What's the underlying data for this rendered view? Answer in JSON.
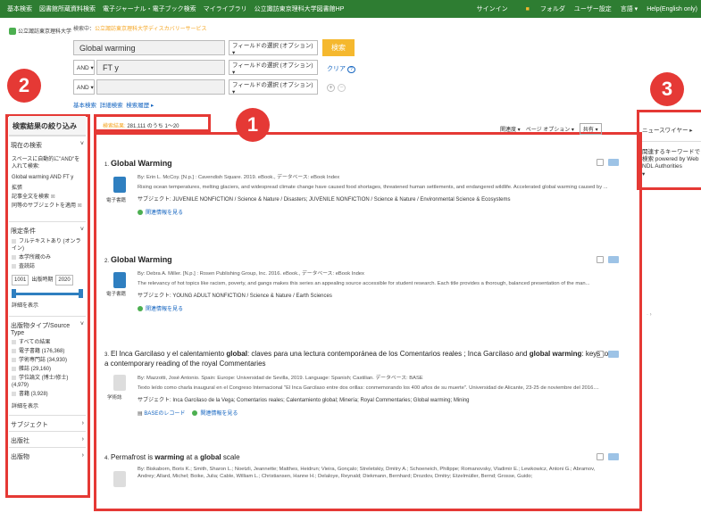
{
  "topnav": {
    "left": [
      "基本検索",
      "図書館所蔵資料検索",
      "電子ジャーナル・電子ブック検索",
      "マイライブラリ",
      "公立諏訪東京理科大学図書館HP"
    ],
    "right": [
      "サインイン",
      "フォルダ",
      "ユーザー設定",
      "言語 ▾",
      "Help(English only)"
    ]
  },
  "logo_text": "公立諏訪東京理科大学",
  "search": {
    "header_prefix": "検索中：",
    "header_highlight": "公立諏訪東京理科大学ディスカバリーサービス",
    "row1_value": "Global warming",
    "row2_op": "AND ▾",
    "row2_value": "FT y",
    "row3_op": "AND ▾",
    "row3_value": "",
    "field_select": "フィールドの選択 (オプション) ▾",
    "search_button": "検索",
    "clear": "クリア",
    "help": "?",
    "links": [
      "基本検索",
      "詳細検索",
      "検索履歴 ▸"
    ]
  },
  "annotations": [
    "2",
    "1",
    "3"
  ],
  "sidebar": {
    "title": "検索結果の絞り込み",
    "current_search": "現在の検索",
    "hint": "スペースに自動的に\"AND\"を入れて検索:",
    "query": "Global warming AND FT y",
    "expanders": "拡張",
    "expand1": "記事全文を検索",
    "expand2": "同等のサブジェクトを適用",
    "limiters": "限定条件",
    "lim1": "フルテキストあり (オンライン)",
    "lim2": "本学所蔵のみ",
    "lim3": "査読誌",
    "year_from": "1001",
    "year_label": "出版時期",
    "year_to": "2020",
    "show_more1": "詳細を表示",
    "source_type": "出版物タイプ/Source Type",
    "types": [
      "すべての結果",
      "電子書籍 (176,368)",
      "学術専門誌 (34,930)",
      "雑誌 (29,160)",
      "学位論文 (博士/修士) (4,979)",
      "書籍 (3,928)"
    ],
    "show_more2": "詳細を表示",
    "facets": [
      "サブジェクト",
      "出版社",
      "出版物"
    ]
  },
  "results_header": {
    "count_prefix": "検索結果:",
    "count": "281,111 のうち 1〜20",
    "sort": "関連度 ▾",
    "page_options": "ページ オプション ▾",
    "share": "共有 ▾"
  },
  "results": [
    {
      "num": "1.",
      "title": "Global Warming",
      "by": "By: Erin L. McCoy. [N.p.] : Cavendish Square. 2019. eBook., データベース: eBook Index",
      "abstract": "Rising ocean temperatures, melting glaciers, and widespread climate change have caused food shortages, threatened human settlements, and endangered wildlife. Accelerated global warming caused by ...",
      "subject": "サブジェクト: JUVENILE NONFICTION / Science & Nature / Disasters; JUVENILE NONFICTION / Science & Nature / Environmental Science & Ecosystems",
      "related": "関連情報を見る",
      "type": "電子書籍"
    },
    {
      "num": "2.",
      "title": "Global Warming",
      "by": "By: Debra A. Miller. [N.p.] : Rosen Publishing Group, Inc. 2016. eBook., データベース: eBook Index",
      "abstract": "The relevancy of hot topics like racism, poverty, and gangs makes this series an appealing source accessible for student research. Each title provides a thorough, balanced presentation of the man...",
      "subject": "サブジェクト: YOUNG ADULT NONFICTION / Science & Nature / Earth Sciences",
      "related": "関連情報を見る",
      "type": "電子書籍"
    },
    {
      "num": "3.",
      "title_a": "El Inca Garcilaso y el calentamiento ",
      "title_b": "global",
      "title_c": ": claves para una lectura contemporánea de los Comentarios reales ; Inca Garcilaso and ",
      "title_d": "global warming",
      "title_e": ": keys to a contemporary reading of the royal Commentaries",
      "by": "By: Mazzotti, José Antonio. Spain: Europe: Universidad de Sevilla, 2019. Language: Spanish; Castilian. データベース: BASE",
      "abstract": "Texto leído como charla inaugural en el Congreso Internacional \"El Inca Garcilaso entre dos orillas: conmemorando los 400 años de su muerte\". Universidad de Alicante, 23-25 de noviembre del 2016....",
      "subject": "サブジェクト: Inca Garcilaso de la Vega; Comentarios reales; Calentamiento global; Minería; Royal Commentaries; Global warming; Mining",
      "base_record": "BASEのレコード",
      "related": "関連情報を見る",
      "type": "学術誌"
    },
    {
      "num": "4.",
      "title_a": "Permafrost is ",
      "title_b": "warming",
      "title_c": " at a ",
      "title_d": "global",
      "title_e": " scale",
      "by": "By: Biskaborn, Boris K.; Smith, Sharon L.; Noetzli, Jeannette; Matthes, Heidrun; Vieira, Gonçalo; Streletskiy, Dmitry A.; Schoeneich, Philippe; Romanovsky, Vladimir E.; Lewkowicz, Antoni G.; Abramov, Andrey; Allard, Michel; Boike, Julia; Cable, William L.; Christiansen, Hanne H.; Delaloye, Reynald; Diekmann, Bernhard; Drozdov, Dmitry; Etzelmüller, Bernd; Grosse, Guido;"
    }
  ],
  "rightpanel": {
    "news": "ニュースワイヤー ▸",
    "related_kw": "関連するキーワードで検索 powered by Web NDL Authorities",
    "arrow": "▾"
  }
}
